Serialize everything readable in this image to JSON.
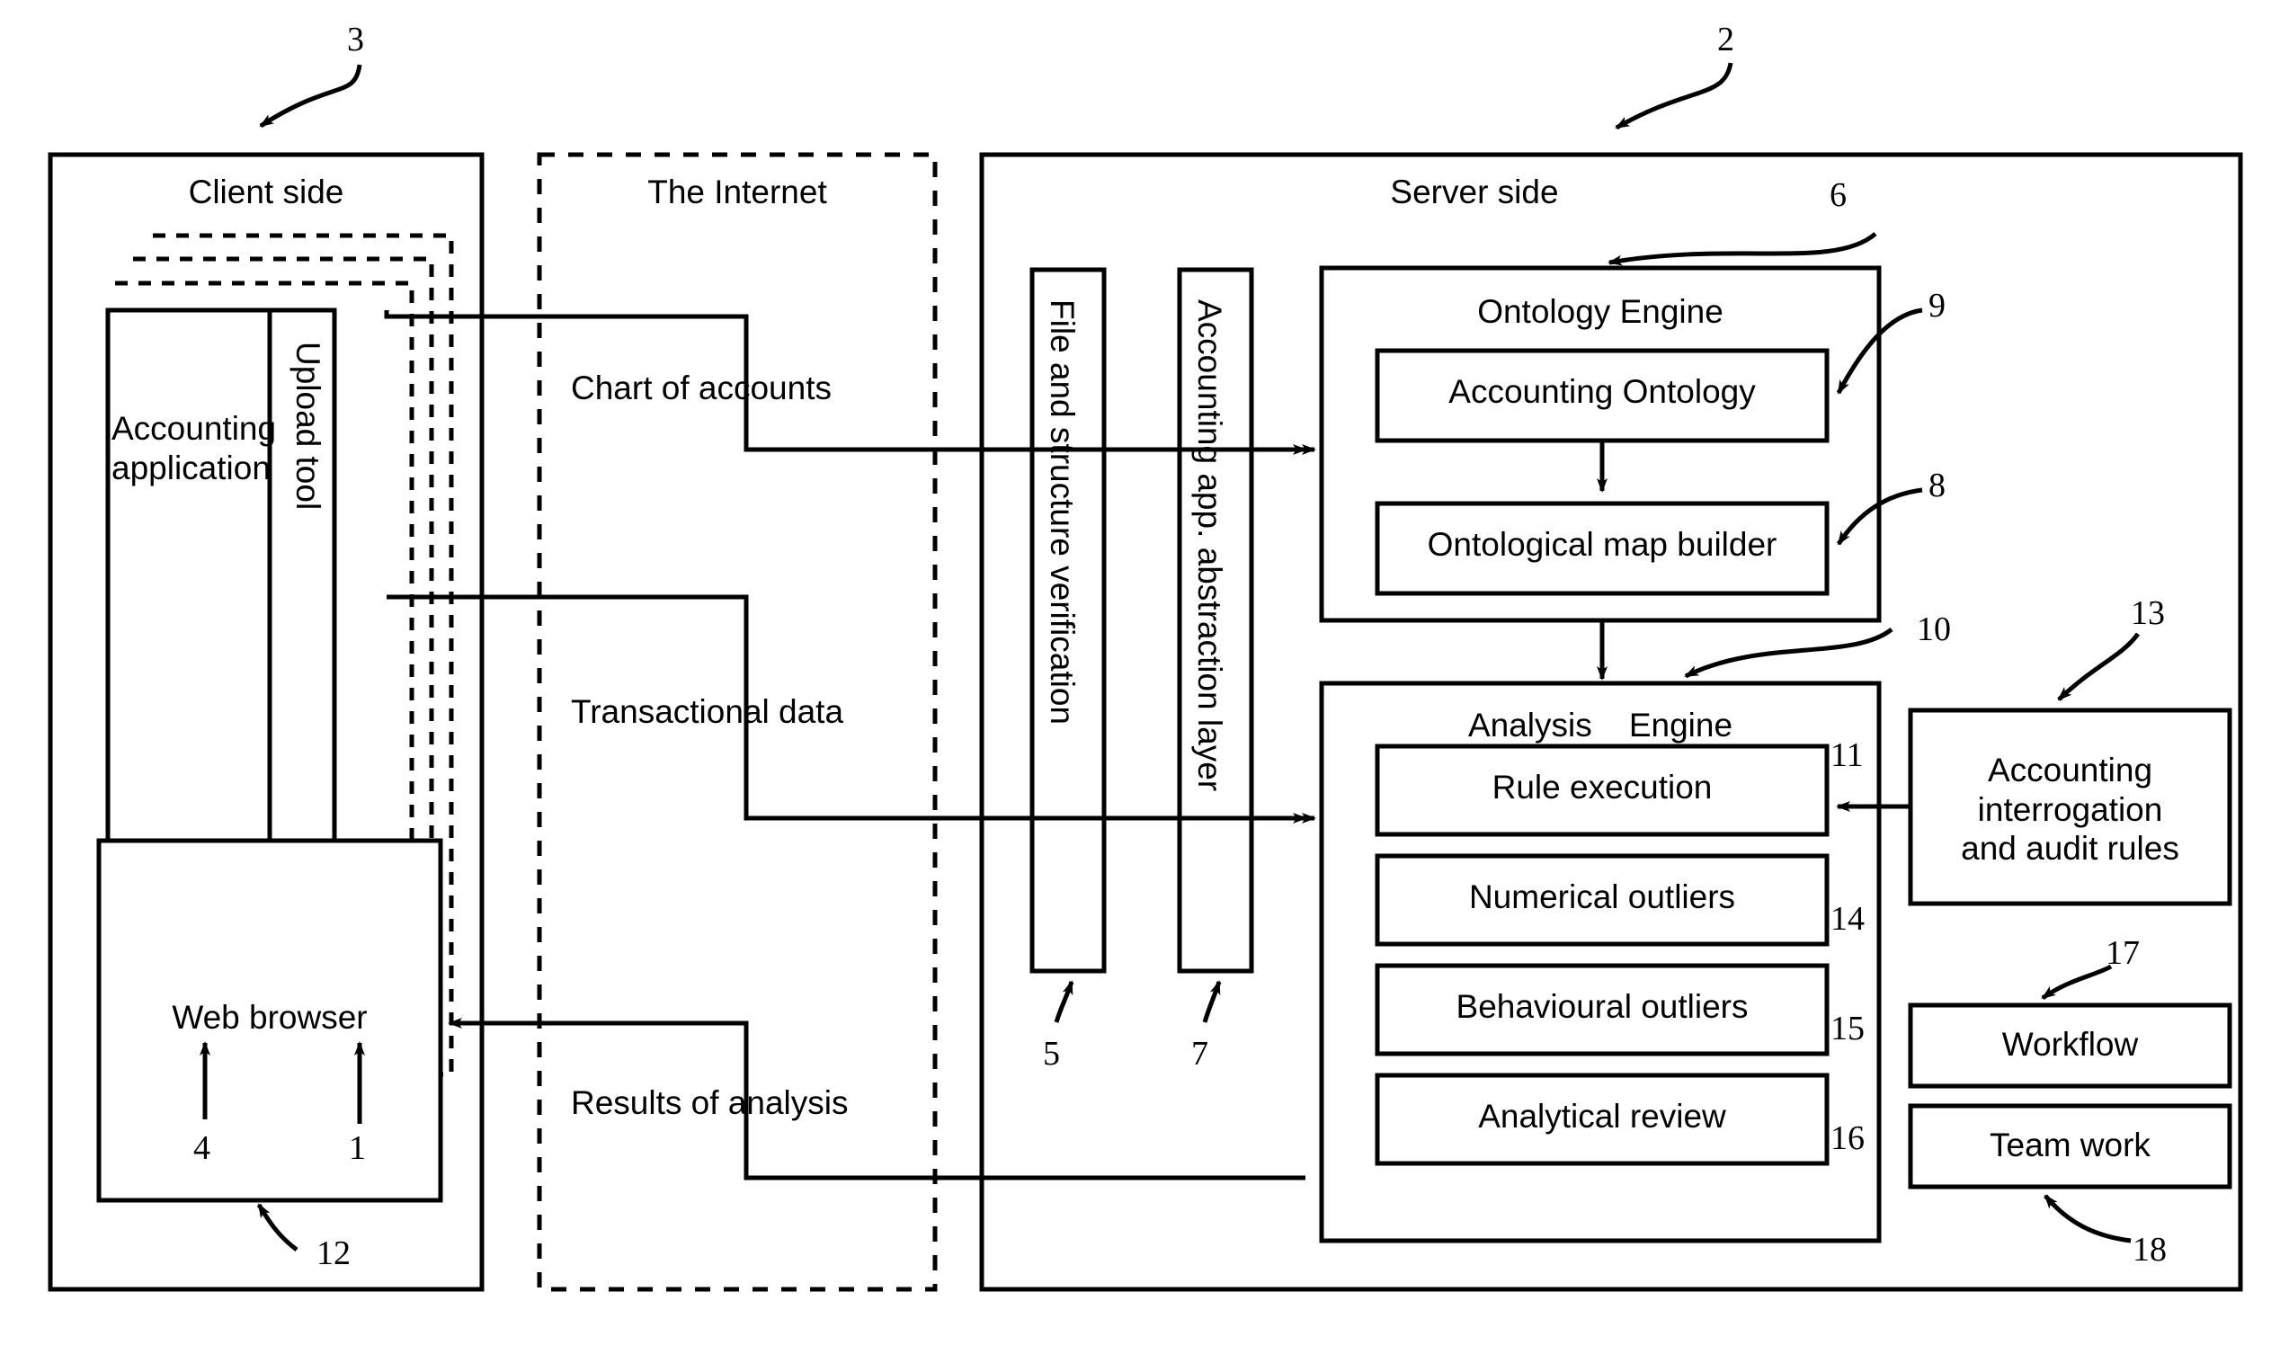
{
  "figure": {
    "type": "patent-block-diagram",
    "background": "#ffffff",
    "stroke": "#000000"
  },
  "panels": {
    "client": {
      "title": "Client side",
      "ref": "3"
    },
    "internet": {
      "title": "The Internet",
      "ref": ""
    },
    "server": {
      "title": "Server side",
      "ref": "2"
    }
  },
  "client_side": {
    "accounting_application": {
      "label": "Accounting\napplication",
      "ref": "4"
    },
    "upload_tool": {
      "label": "Upload tool",
      "ref": "1",
      "orientation": "vertical"
    },
    "web_browser": {
      "label": "Web browser",
      "ref": "12"
    }
  },
  "internet_flows": [
    {
      "label": "Chart of accounts",
      "direction": "client-to-server"
    },
    {
      "label": "Transactional data",
      "direction": "client-to-server"
    },
    {
      "label": "Results of analysis",
      "direction": "server-to-client"
    }
  ],
  "server_side": {
    "file_verification": {
      "label": "File and structure verification",
      "ref": "5",
      "orientation": "vertical"
    },
    "abstraction_layer": {
      "label": "Accounting app. abstraction layer",
      "ref": "7",
      "orientation": "vertical"
    },
    "ontology_engine": {
      "title": "Ontology Engine",
      "ref": "6",
      "children": [
        {
          "label": "Accounting Ontology",
          "ref": "9"
        },
        {
          "label": "Ontological map builder",
          "ref": "8"
        }
      ]
    },
    "analysis_engine": {
      "title": "Analysis    Engine",
      "ref": "10",
      "children": [
        {
          "label": "Rule execution",
          "ref": "11"
        },
        {
          "label": "Numerical outliers",
          "ref": "14"
        },
        {
          "label": "Behavioural outliers",
          "ref": "15"
        },
        {
          "label": "Analytical review",
          "ref": "16"
        }
      ]
    },
    "side_modules": [
      {
        "label": "Accounting\ninterrogation\nand audit rules",
        "ref": "13"
      },
      {
        "label": "Workflow",
        "ref": "17"
      },
      {
        "label": "Team work",
        "ref": "18"
      }
    ]
  },
  "reference_numerals": [
    "1",
    "2",
    "3",
    "4",
    "5",
    "6",
    "7",
    "8",
    "9",
    "10",
    "11",
    "12",
    "13",
    "14",
    "15",
    "16",
    "17",
    "18"
  ]
}
